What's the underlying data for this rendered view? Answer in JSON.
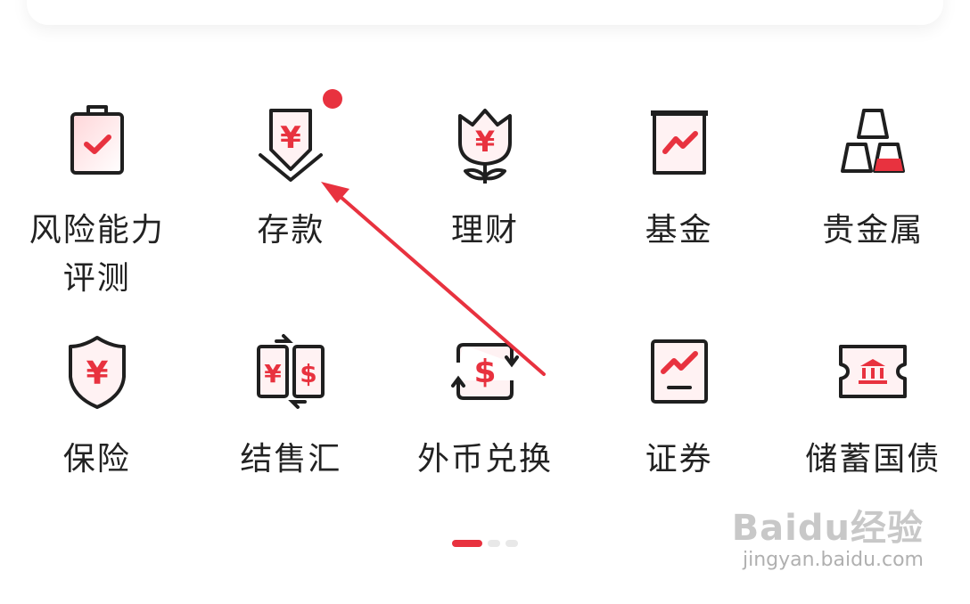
{
  "colors": {
    "accent": "#e8323f",
    "icon_stroke": "#1f1f1f",
    "text": "#222222"
  },
  "grid": {
    "items": [
      {
        "label": "风险能力",
        "label2": "评测",
        "icon": "clipboard-check-icon",
        "badge": false
      },
      {
        "label": "存款",
        "label2": "",
        "icon": "deposit-yen-icon",
        "badge": true
      },
      {
        "label": "理财",
        "label2": "",
        "icon": "tulip-yen-icon",
        "badge": false
      },
      {
        "label": "基金",
        "label2": "",
        "icon": "fund-chart-icon",
        "badge": false
      },
      {
        "label": "贵金属",
        "label2": "",
        "icon": "gold-bars-icon",
        "badge": false
      },
      {
        "label": "保险",
        "label2": "",
        "icon": "shield-yen-icon",
        "badge": false
      },
      {
        "label": "结售汇",
        "label2": "",
        "icon": "yen-dollar-exchange-icon",
        "badge": false
      },
      {
        "label": "外币兑换",
        "label2": "",
        "icon": "dollar-exchange-icon",
        "badge": false
      },
      {
        "label": "证券",
        "label2": "",
        "icon": "securities-chart-icon",
        "badge": false
      },
      {
        "label": "储蓄国债",
        "label2": "",
        "icon": "bank-ticket-icon",
        "badge": false
      }
    ]
  },
  "pager": {
    "pages": 3,
    "active": 1
  },
  "watermark": {
    "brand": "Baidu经验",
    "url": "jingyan.baidu.com"
  }
}
